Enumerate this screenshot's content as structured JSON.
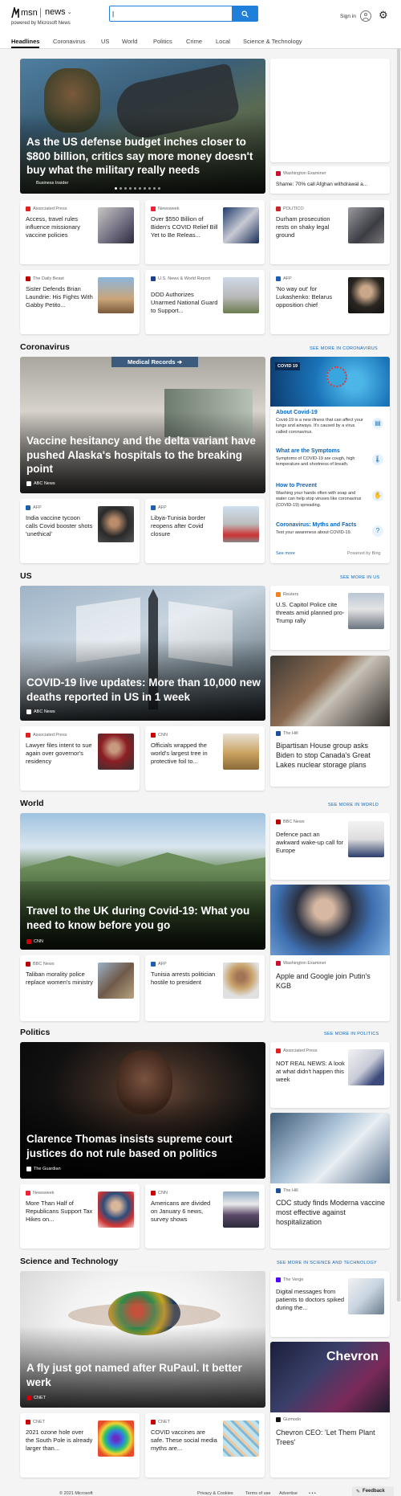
{
  "header": {
    "brand": "msn",
    "product": "news",
    "powered_by": "powered by Microsoft News",
    "search": {
      "value": "|",
      "placeholder": ""
    },
    "sign_in": "Sign in"
  },
  "nav": {
    "tabs": [
      "Headlines",
      "Coronavirus",
      "US",
      "World",
      "Politics",
      "Crime",
      "Local",
      "Science & Technology"
    ]
  },
  "headlines": {
    "hero": {
      "title": "As the US defense budget inches closer to $800 billion, critics say more money doesn't buy what the military really needs",
      "source": "Business Insider"
    },
    "side": {
      "source": "Washington Examiner",
      "title": "Shame: 70% call Afghan withdrawal a..."
    },
    "row1": [
      {
        "source": "Associated Press",
        "title": "Access, travel rules influence missionary vaccine policies"
      },
      {
        "source": "Newsweek",
        "title": "Over $550 Billion of Biden's COVID Relief Bill Yet to Be Releas..."
      },
      {
        "source": "POLITICO",
        "title": "Durham prosecution rests on shaky legal ground"
      }
    ],
    "row2": [
      {
        "source": "The Daily Beast",
        "title": "Sister Defends Brian Laundrie: His Fights With Gabby Petito..."
      },
      {
        "source": "U.S. News & World Report",
        "title": "DOD Authorizes Unarmed National Guard to Support..."
      },
      {
        "source": "AFP",
        "title": "'No way out' for Lukashenko: Belarus opposition chief"
      }
    ]
  },
  "coronavirus": {
    "heading": "Coronavirus",
    "more": "SEE MORE IN CORONAVIRUS",
    "hero": {
      "title": "Vaccine hesitancy and the delta variant have pushed Alaska's hospitals to the breaking point",
      "source": "ABC News",
      "sign": "Medical Records"
    },
    "row": [
      {
        "source": "AFP",
        "title": "India vaccine tycoon calls Covid booster shots 'unethical'"
      },
      {
        "source": "AFP",
        "title": "Libya-Tunisia border reopens after Covid closure"
      }
    ],
    "panel": {
      "badge": "COVID 19",
      "items": [
        {
          "title": "About Covid-19",
          "text": "Covid-19 is a new illness that can affect your lungs and airways. It's caused by a virus called coronavirus."
        },
        {
          "title": "What are the Symptoms",
          "text": "Symptoms of COVID-19 are cough, high temperature and shortness of breath."
        },
        {
          "title": "How to Prevent",
          "text": "Washing your hands often with soap and water can help stop viruses like coronavirus (COVID-19) spreading."
        },
        {
          "title": "Coronavirus: Myths and Facts",
          "text": "Test your awareness about COVID-19."
        }
      ],
      "see_more": "See more",
      "powered": "Powered by Bing"
    }
  },
  "us": {
    "heading": "US",
    "more": "SEE MORE IN US",
    "hero": {
      "title": "COVID-19 live updates: More than 10,000 new deaths reported in US in 1 week",
      "source": "ABC News"
    },
    "side1": {
      "source": "Reuters",
      "title": "U.S. Capitol Police cite threats amid planned pro-Trump rally"
    },
    "side2": {
      "source": "The Hill",
      "title": "Bipartisan House group asks Biden to stop Canada's Great Lakes nuclear storage plans"
    },
    "row": [
      {
        "source": "Associated Press",
        "title": "Lawyer files intent to sue again over governor's residency"
      },
      {
        "source": "CNN",
        "title": "Officials wrapped the world's largest tree in protective foil to..."
      }
    ]
  },
  "world": {
    "heading": "World",
    "more": "SEE MORE IN WORLD",
    "hero": {
      "title": "Travel to the UK during Covid-19: What you need to know before you go",
      "source": "CNN"
    },
    "side1": {
      "source": "BBC News",
      "title": "Defence pact an awkward wake-up call for Europe"
    },
    "side2": {
      "source": "Washington Examiner",
      "title": "Apple and Google join Putin's KGB"
    },
    "row": [
      {
        "source": "BBC News",
        "title": "Taliban morality police replace women's ministry"
      },
      {
        "source": "AFP",
        "title": "Tunisia arrests politician hostile to president"
      }
    ]
  },
  "politics": {
    "heading": "Politics",
    "more": "SEE MORE IN POLITICS",
    "hero": {
      "title": "Clarence Thomas insists supreme court justices do not rule based on politics",
      "source": "The Guardian"
    },
    "side1": {
      "source": "Associated Press",
      "title": "NOT REAL NEWS: A look at what didn't happen this week"
    },
    "side2": {
      "source": "The Hill",
      "title": "CDC study finds Moderna vaccine most effective against hospitalization"
    },
    "row": [
      {
        "source": "Newsweek",
        "title": "More Than Half of Republicans Support Tax Hikes on..."
      },
      {
        "source": "CNN",
        "title": "Americans are divided on January 6 news, survey shows"
      }
    ]
  },
  "science": {
    "heading": "Science and Technology",
    "more": "SEE MORE IN SCIENCE AND TECHNOLOGY",
    "hero": {
      "title": "A fly just got named after RuPaul. It better werk",
      "source": "CNET"
    },
    "side1": {
      "source": "The Verge",
      "title": "Digital messages from patients to doctors spiked during the..."
    },
    "side2": {
      "source": "Gizmodo",
      "title": "Chevron CEO: 'Let Them Plant Trees'",
      "image_text": "Chevron"
    },
    "row": [
      {
        "source": "CNET",
        "title": "2021 ozone hole over the South Pole is already larger than..."
      },
      {
        "source": "CNET",
        "title": "COVID vaccines are safe. These social media myths are..."
      }
    ]
  },
  "footer": {
    "copyright": "© 2021 Microsoft",
    "links": [
      "Privacy & Cookies",
      "Terms of use",
      "Advertise"
    ],
    "ellipsis": "• • •",
    "feedback": "Feedback"
  },
  "colors": {
    "accent": "#0a66c2",
    "search_button": "#1f7fd9",
    "covid_panel": "#1a73b8"
  }
}
